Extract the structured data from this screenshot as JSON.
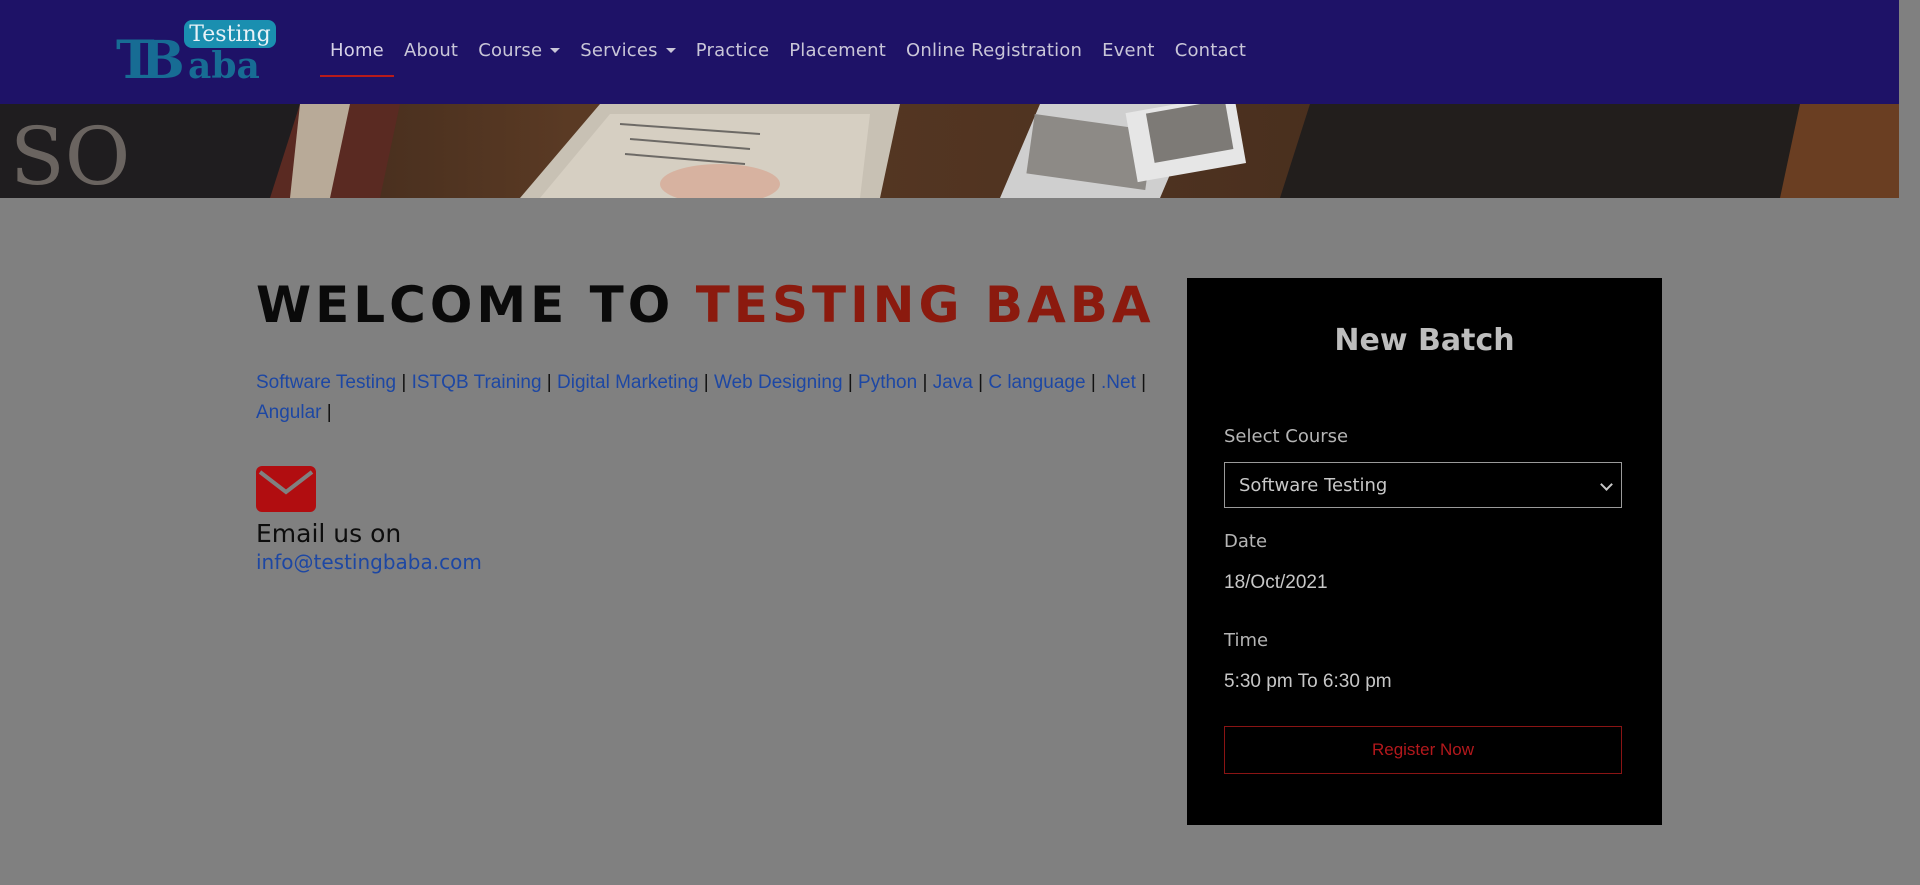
{
  "logo": {
    "top_text": "Testing",
    "monogram": "TB",
    "bottom_text": "aba"
  },
  "nav": {
    "items": [
      {
        "label": "Home",
        "active": true
      },
      {
        "label": "About"
      },
      {
        "label": "Course",
        "dropdown": true
      },
      {
        "label": "Services",
        "dropdown": true
      },
      {
        "label": "Practice"
      },
      {
        "label": "Placement"
      },
      {
        "label": "Online Registration"
      },
      {
        "label": "Event"
      },
      {
        "label": "Contact"
      }
    ]
  },
  "welcome": {
    "prefix": "WELCOME TO ",
    "highlight": "TESTING BABA"
  },
  "courses": {
    "links": [
      "Software Testing",
      "ISTQB Training",
      "Digital Marketing",
      "Web Designing",
      "Python",
      "Java",
      "C language",
      ".Net",
      "Angular"
    ],
    "separator": "|"
  },
  "contact": {
    "email_label": "Email us on",
    "email": "info@testingbaba.com"
  },
  "batch": {
    "title": "New Batch",
    "select_label": "Select Course",
    "selected_course": "Software Testing",
    "date_label": "Date",
    "date_value": "18/Oct/2021",
    "time_label": "Time",
    "time_value": "5:30 pm To 6:30 pm",
    "register_label": "Register Now"
  },
  "colors": {
    "nav_bg": "#1e1267",
    "overlay_bg": "#808080",
    "accent_red": "#8b1a0e",
    "link_blue": "#1d47a3",
    "card_bg": "#000000"
  }
}
